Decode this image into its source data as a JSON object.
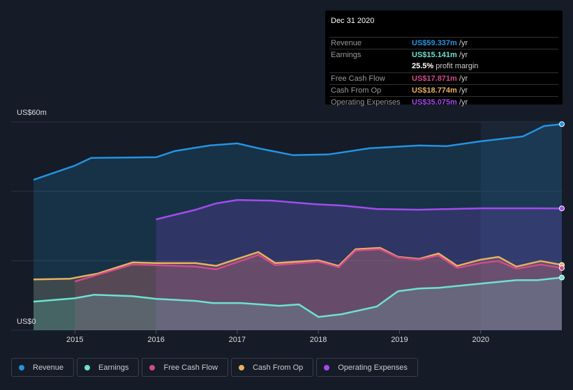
{
  "tooltip": {
    "date": "Dec 31 2020",
    "rows": [
      {
        "label": "Revenue",
        "value": "US$59.337m",
        "unit": "/yr",
        "color": "#2394df"
      },
      {
        "label": "Earnings",
        "value": "US$15.141m",
        "unit": "/yr",
        "color": "#6de2d1"
      },
      {
        "label": "",
        "value": "25.5%",
        "unit": "profit margin",
        "color": "#ffffff"
      },
      {
        "label": "Free Cash Flow",
        "value": "US$17.871m",
        "unit": "/yr",
        "color": "#d14a8b"
      },
      {
        "label": "Cash From Op",
        "value": "US$18.774m",
        "unit": "/yr",
        "color": "#e8b15f"
      },
      {
        "label": "Operating Expenses",
        "value": "US$35.075m",
        "unit": "/yr",
        "color": "#a24ced"
      }
    ]
  },
  "legend": [
    {
      "label": "Revenue",
      "color": "#2394df"
    },
    {
      "label": "Earnings",
      "color": "#6de2d1"
    },
    {
      "label": "Free Cash Flow",
      "color": "#d14a8b"
    },
    {
      "label": "Cash From Op",
      "color": "#e8b15f"
    },
    {
      "label": "Operating Expenses",
      "color": "#a24ced"
    }
  ],
  "chart_data": {
    "type": "area",
    "ylabel_top": "US$60m",
    "ylabel_bottom": "US$0",
    "ylim": [
      0,
      60
    ],
    "xlim": [
      2014.49,
      2021
    ],
    "xticks": [
      "2015",
      "2016",
      "2017",
      "2018",
      "2019",
      "2020"
    ],
    "grid": true,
    "highlight_from": 2020,
    "series": [
      {
        "name": "Revenue",
        "color": "#2394df",
        "points": [
          [
            2014.49,
            43.3
          ],
          [
            2015,
            47.4
          ],
          [
            2015.2,
            49.6
          ],
          [
            2016,
            49.8
          ],
          [
            2016.23,
            51.6
          ],
          [
            2016.66,
            53.2
          ],
          [
            2017,
            53.8
          ],
          [
            2017.26,
            52.4
          ],
          [
            2017.69,
            50.4
          ],
          [
            2018.12,
            50.6
          ],
          [
            2018.63,
            52.4
          ],
          [
            2019.24,
            53.2
          ],
          [
            2019.58,
            53.0
          ],
          [
            2020,
            54.4
          ],
          [
            2020.52,
            55.8
          ],
          [
            2020.78,
            58.8
          ],
          [
            2021,
            59.337
          ]
        ]
      },
      {
        "name": "Operating Expenses",
        "color": "#a24ced",
        "points": [
          [
            2016,
            31.9
          ],
          [
            2016.49,
            34.7
          ],
          [
            2016.74,
            36.5
          ],
          [
            2017,
            37.5
          ],
          [
            2017.43,
            37.3
          ],
          [
            2017.95,
            36.3
          ],
          [
            2018.29,
            35.9
          ],
          [
            2018.72,
            34.9
          ],
          [
            2019.24,
            34.7
          ],
          [
            2020,
            35.1
          ],
          [
            2021,
            35.075
          ]
        ]
      },
      {
        "name": "Cash From Op",
        "color": "#e8b15f",
        "points": [
          [
            2014.49,
            14.6
          ],
          [
            2014.94,
            14.8
          ],
          [
            2015.28,
            16.3
          ],
          [
            2015.71,
            19.5
          ],
          [
            2016,
            19.3
          ],
          [
            2016.49,
            19.3
          ],
          [
            2016.74,
            18.5
          ],
          [
            2017,
            20.5
          ],
          [
            2017.26,
            22.5
          ],
          [
            2017.47,
            19.3
          ],
          [
            2018,
            20.1
          ],
          [
            2018.25,
            18.5
          ],
          [
            2018.46,
            23.3
          ],
          [
            2018.76,
            23.7
          ],
          [
            2018.98,
            21.1
          ],
          [
            2019.24,
            20.5
          ],
          [
            2019.48,
            22.1
          ],
          [
            2019.71,
            18.5
          ],
          [
            2020,
            20.3
          ],
          [
            2020.22,
            21.1
          ],
          [
            2020.44,
            18.3
          ],
          [
            2020.74,
            19.9
          ],
          [
            2021,
            18.774
          ]
        ]
      },
      {
        "name": "Free Cash Flow",
        "color": "#d14a8b",
        "points": [
          [
            2015,
            14.0
          ],
          [
            2015.71,
            18.9
          ],
          [
            2016,
            18.7
          ],
          [
            2016.49,
            18.3
          ],
          [
            2016.74,
            17.5
          ],
          [
            2017.26,
            21.7
          ],
          [
            2017.47,
            18.7
          ],
          [
            2018,
            19.7
          ],
          [
            2018.25,
            18.1
          ],
          [
            2018.46,
            22.9
          ],
          [
            2018.76,
            23.3
          ],
          [
            2018.98,
            20.9
          ],
          [
            2019.24,
            20.3
          ],
          [
            2019.48,
            21.5
          ],
          [
            2019.71,
            17.9
          ],
          [
            2020,
            19.3
          ],
          [
            2020.22,
            19.9
          ],
          [
            2020.44,
            17.7
          ],
          [
            2020.74,
            18.9
          ],
          [
            2021,
            17.871
          ]
        ]
      },
      {
        "name": "Earnings",
        "color": "#6de2d1",
        "points": [
          [
            2014.49,
            8.2
          ],
          [
            2015,
            9.2
          ],
          [
            2015.24,
            10.2
          ],
          [
            2015.71,
            9.8
          ],
          [
            2016,
            9.0
          ],
          [
            2016.49,
            8.4
          ],
          [
            2016.7,
            7.8
          ],
          [
            2017.04,
            7.8
          ],
          [
            2017.52,
            7.0
          ],
          [
            2017.76,
            7.4
          ],
          [
            2018,
            3.8
          ],
          [
            2018.29,
            4.6
          ],
          [
            2018.72,
            6.8
          ],
          [
            2018.98,
            11.2
          ],
          [
            2019.24,
            12.0
          ],
          [
            2019.49,
            12.2
          ],
          [
            2020,
            13.4
          ],
          [
            2020.44,
            14.4
          ],
          [
            2020.7,
            14.4
          ],
          [
            2021,
            15.141
          ]
        ]
      }
    ]
  }
}
